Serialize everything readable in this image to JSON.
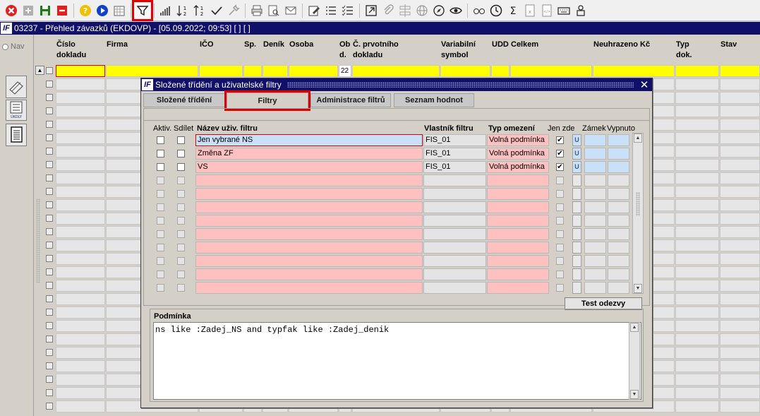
{
  "window_title": "03237 - Přehled závazků (EKDOVP) - [05.09.2022; 09:53]  [ ]  [ ]",
  "app_logo": "IF",
  "toolbar": [
    "close-icon",
    "add-icon",
    "save-icon",
    "delete-icon",
    "help-icon",
    "play-icon",
    "calendar-icon",
    "filter-icon",
    "chart-bars-icon",
    "sort-ascending-icon",
    "sort-descending-icon",
    "check-icon",
    "wrench-icon",
    "print-icon",
    "print-preview-icon",
    "mail-icon",
    "edit-icon",
    "list-icon",
    "checklist-icon",
    "open-external-icon",
    "attach-icon",
    "split-icon",
    "globe-icon",
    "compass-icon",
    "eye-icon",
    "glasses-icon",
    "clock-icon",
    "sum-icon",
    "excel-icon",
    "xml-icon",
    "keyboard-icon",
    "user-icon"
  ],
  "nav": {
    "label": "Nav",
    "ukoly": "ÚKOLY"
  },
  "grid": {
    "headers": [
      {
        "key": "cislo",
        "l1": "Číslo",
        "l2": "dokladu"
      },
      {
        "key": "firma",
        "l1": "Firma",
        "l2": ""
      },
      {
        "key": "ico",
        "l1": "IČO",
        "l2": ""
      },
      {
        "key": "sp",
        "l1": "Sp.",
        "l2": ""
      },
      {
        "key": "denik",
        "l1": "Deník",
        "l2": ""
      },
      {
        "key": "osoba",
        "l1": "Osoba",
        "l2": ""
      },
      {
        "key": "obd",
        "l1": "Ob",
        "l2": "d."
      },
      {
        "key": "cprvot",
        "l1": "Č. prvotního",
        "l2": "dokladu"
      },
      {
        "key": "vs",
        "l1": "Variabilní",
        "l2": "symbol"
      },
      {
        "key": "udd",
        "l1": "UDD",
        "l2": ""
      },
      {
        "key": "celkem",
        "l1": "Celkem",
        "l2": ""
      },
      {
        "key": "neuhr",
        "l1": "Neuhrazeno Kč",
        "l2": ""
      },
      {
        "key": "typdok",
        "l1": "Typ",
        "l2": "dok."
      },
      {
        "key": "stav",
        "l1": "Stav",
        "l2": ""
      }
    ],
    "first_row_obd_value": "22"
  },
  "modal": {
    "title": "Složené třídění a uživatelské filtry",
    "tabs": [
      "Složené třídění",
      "Filtry",
      "Administrace filtrů",
      "Seznam hodnot"
    ],
    "active_tab": 1,
    "columns": {
      "aktiv": "Aktiv.",
      "sdilet": "Sdílet",
      "nazev": "Název uživ. filtru",
      "vlastnik": "Vlastník filtru",
      "typ": "Typ omezení",
      "jen_zde": "Jen zde",
      "zamek": "Zámek",
      "vypnuto": "Vypnuto"
    },
    "filters": [
      {
        "name": "Jen vybrané NS",
        "owner": "FIS_01",
        "type": "Volná podmínka",
        "jen_zde": true,
        "u": "U",
        "selected": true
      },
      {
        "name": "Změna ZF",
        "owner": "FIS_01",
        "type": "Volná podmínka",
        "jen_zde": true,
        "u": "U",
        "selected": false
      },
      {
        "name": "VS",
        "owner": "FIS_01",
        "type": "Volná podmínka",
        "jen_zde": true,
        "u": "U",
        "selected": false
      },
      {},
      {},
      {},
      {},
      {},
      {},
      {},
      {},
      {}
    ],
    "test_button": "Test odezvy",
    "condition_label": "Podmínka",
    "condition_text": "ns like :Zadej_NS and typfak like :Zadej_denik"
  },
  "colors": {
    "title_bar": "#10106a",
    "highlight": "#e00000",
    "filter_row": "#ffc0c0",
    "selected_cell": "#c8e0f8",
    "grid_yellow": "#ffff00"
  }
}
